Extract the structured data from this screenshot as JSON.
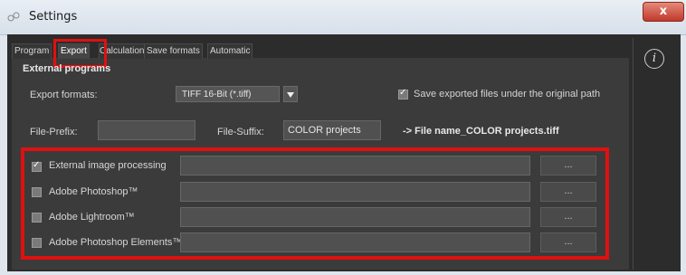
{
  "window": {
    "title": "Settings",
    "close_label": "x",
    "app_icon": "settings-app-icon"
  },
  "tabs": [
    {
      "label": "Program",
      "active": false
    },
    {
      "label": "Export",
      "active": true
    },
    {
      "label": "Calculation",
      "active": false
    },
    {
      "label": "Save formats",
      "active": false
    },
    {
      "label": "Automatic",
      "active": false
    }
  ],
  "section": {
    "title": "External programs"
  },
  "export": {
    "formats_label": "Export formats:",
    "format_value": "TIFF 16-Bit (*.tiff)",
    "save_original_label": "Save exported files under the original path",
    "save_original_checked": true,
    "prefix_label": "File-Prefix:",
    "prefix_value": "",
    "suffix_label": "File-Suffix:",
    "suffix_value": "COLOR projects",
    "preview_text": "-> File name_COLOR projects.tiff"
  },
  "programs": [
    {
      "label": "External image processing",
      "checked": true,
      "path": "",
      "button": "..."
    },
    {
      "label": "Adobe Photoshop™",
      "checked": false,
      "path": "",
      "button": "..."
    },
    {
      "label": "Adobe Lightroom™",
      "checked": false,
      "path": "",
      "button": "..."
    },
    {
      "label": "Adobe Photoshop Elements™",
      "checked": false,
      "path": "",
      "button": "..."
    }
  ],
  "info_icon": {
    "glyph": "i",
    "name": "info-icon"
  },
  "highlight_color": "#e11010"
}
